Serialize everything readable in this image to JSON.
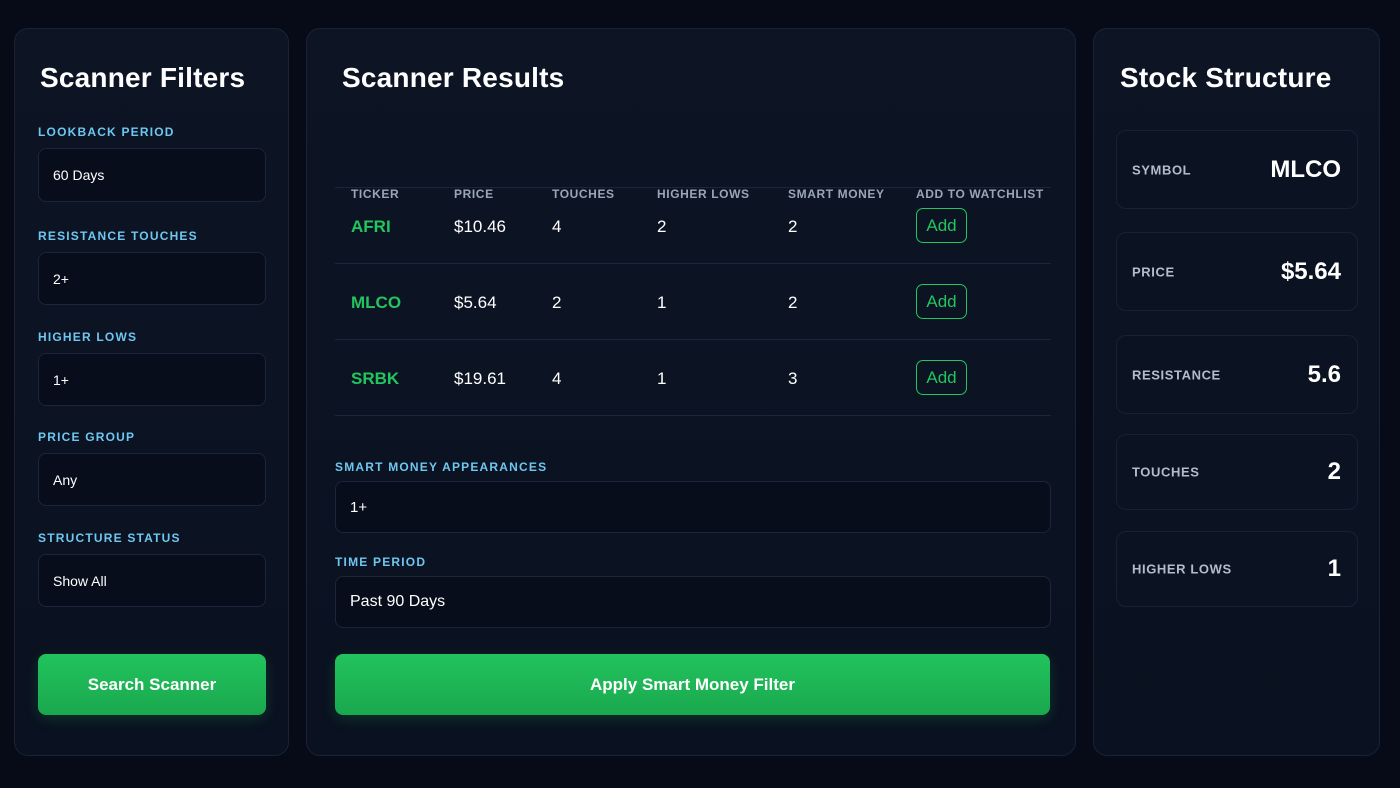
{
  "filters": {
    "title": "Scanner Filters",
    "lookback": {
      "label": "LOOKBACK PERIOD",
      "value": "60 Days"
    },
    "resistance": {
      "label": "RESISTANCE TOUCHES",
      "value": "2+"
    },
    "higher_lows": {
      "label": "HIGHER LOWS",
      "value": "1+"
    },
    "price_group": {
      "label": "PRICE GROUP",
      "value": "Any"
    },
    "structure_status": {
      "label": "STRUCTURE STATUS",
      "value": "Show All"
    },
    "search_button": "Search Scanner"
  },
  "results": {
    "title": "Scanner Results",
    "columns": [
      "TICKER",
      "PRICE",
      "TOUCHES",
      "HIGHER LOWS",
      "SMART MONEY",
      "ADD TO WATCHLIST"
    ],
    "rows": [
      {
        "ticker": "AFRI",
        "price": "$10.46",
        "touches": "4",
        "higher_lows": "2",
        "smart_money": "2",
        "action": "Add"
      },
      {
        "ticker": "MLCO",
        "price": "$5.64",
        "touches": "2",
        "higher_lows": "1",
        "smart_money": "2",
        "action": "Add"
      },
      {
        "ticker": "SRBK",
        "price": "$19.61",
        "touches": "4",
        "higher_lows": "1",
        "smart_money": "3",
        "action": "Add"
      }
    ],
    "smart_money_appearances": {
      "label": "SMART MONEY APPEARANCES",
      "value": "1+"
    },
    "time_period": {
      "label": "TIME PERIOD",
      "value": "Past 90 Days"
    },
    "apply_button": "Apply Smart Money Filter"
  },
  "structure": {
    "title": "Stock Structure",
    "stats": [
      {
        "label": "SYMBOL",
        "value": "MLCO"
      },
      {
        "label": "PRICE",
        "value": "$5.64"
      },
      {
        "label": "RESISTANCE",
        "value": "5.6"
      },
      {
        "label": "TOUCHES",
        "value": "2"
      },
      {
        "label": "HIGHER LOWS",
        "value": "1"
      }
    ]
  },
  "colors": {
    "background": "#060b17",
    "panel": "#0d1525",
    "accent_green": "#22c55e",
    "label_blue": "#6ec7f0"
  }
}
